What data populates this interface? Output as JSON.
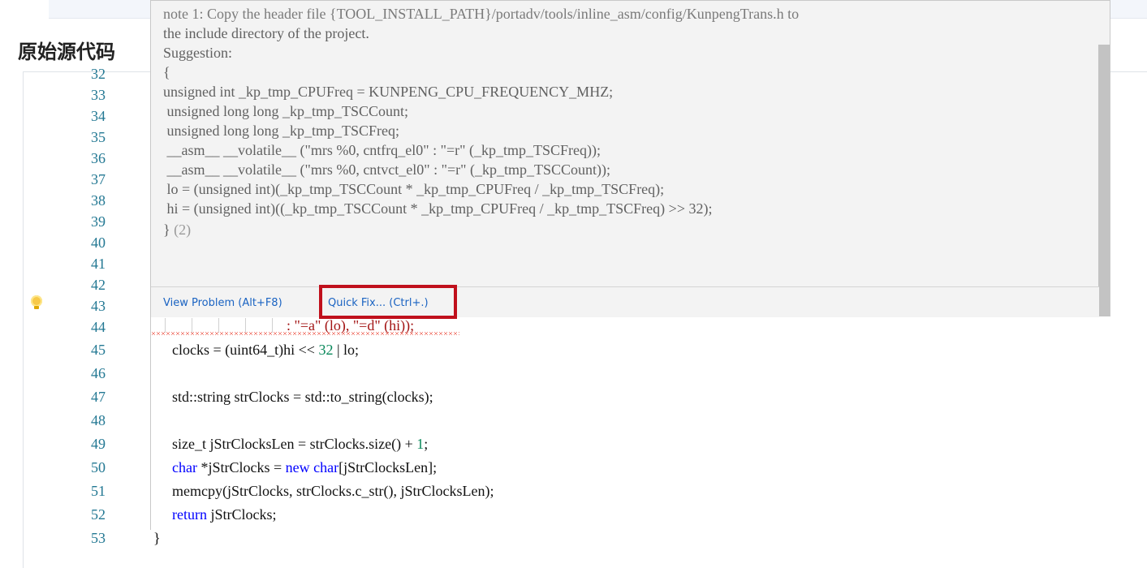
{
  "section_title": "原始源代码",
  "hover": {
    "lines": [
      "note 1: Copy the header file {TOOL_INSTALL_PATH}/portadv/tools/inline_asm/config/KunpengTrans.h to",
      "the include directory of the project.",
      "Suggestion:",
      "{",
      "unsigned int _kp_tmp_CPUFreq = KUNPENG_CPU_FREQUENCY_MHZ;",
      " unsigned long long _kp_tmp_TSCCount;",
      " unsigned long long _kp_tmp_TSCFreq;",
      " __asm__ __volatile__ (\"mrs %0, cntfrq_el0\" : \"=r\" (_kp_tmp_TSCFreq));",
      " __asm__ __volatile__ (\"mrs %0, cntvct_el0\" : \"=r\" (_kp_tmp_TSCCount));",
      " lo = (unsigned int)(_kp_tmp_TSCCount * _kp_tmp_CPUFreq / _kp_tmp_TSCFreq);",
      " hi = (unsigned int)((_kp_tmp_TSCCount * _kp_tmp_CPUFreq / _kp_tmp_TSCFreq) >> 32);",
      "} "
    ],
    "count_suffix": "(2)",
    "view_problem": "View Problem (Alt+F8)",
    "quick_fix": "Quick Fix... (Ctrl+.)"
  },
  "line_numbers": [
    "32",
    "33",
    "34",
    "35",
    "36",
    "37",
    "38",
    "39",
    "40",
    "41",
    "42",
    "43",
    "44",
    "45",
    "46",
    "47",
    "48",
    "49",
    "50",
    "51",
    "52",
    "53"
  ],
  "code": {
    "l43": ": \"=a\" (lo), \"=d\" (hi));",
    "l44_a": "clocks = (uint64_t)hi << ",
    "l44_num": "32",
    "l44_b": " | lo;",
    "l46": "std::string strClocks = std::to_string(clocks);",
    "l48_a": "size_t jStrClocksLen = strClocks.size() + ",
    "l48_num": "1",
    "l48_b": ";",
    "l49_kw1": "char",
    "l49_a": " *jStrClocks = ",
    "l49_kw2": "new",
    "l49_kw3": "char",
    "l49_b": "[jStrClocksLen];",
    "l50": "memcpy(jStrClocks, strClocks.c_str(), jStrClocksLen);",
    "l51_kw": "return",
    "l51_b": " jStrClocks;",
    "l52": "}"
  }
}
